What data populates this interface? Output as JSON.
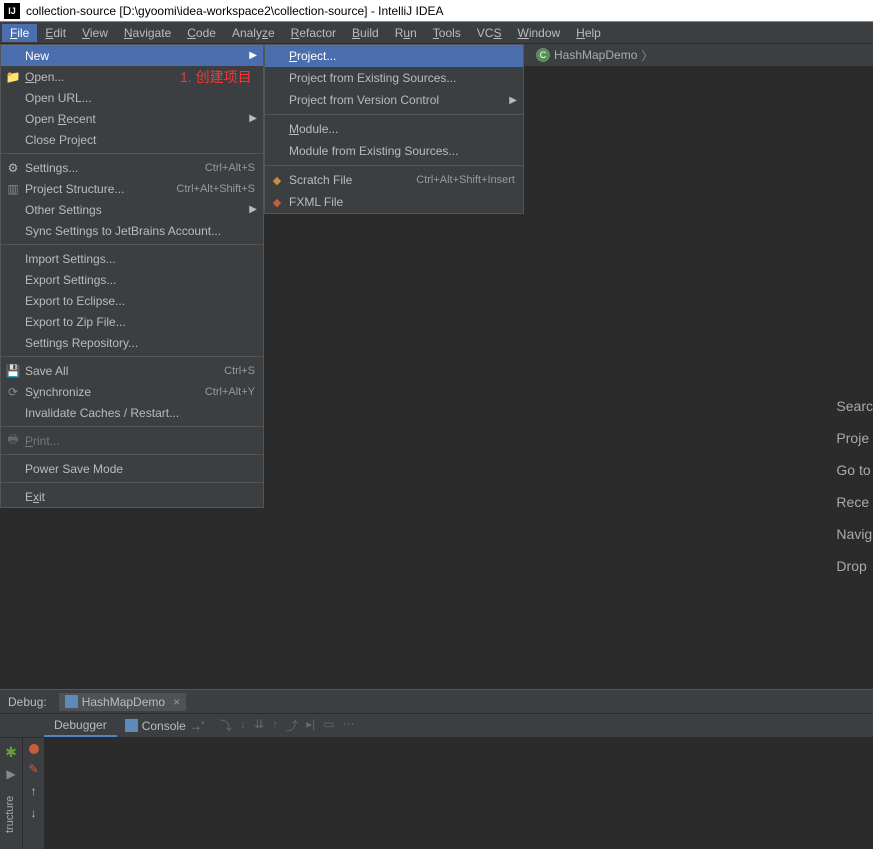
{
  "titlebar": {
    "text": "collection-source [D:\\gyoomi\\idea-workspace2\\collection-source] - IntelliJ IDEA"
  },
  "menubar": {
    "items": [
      "File",
      "Edit",
      "View",
      "Navigate",
      "Code",
      "Analyze",
      "Refactor",
      "Build",
      "Run",
      "Tools",
      "VCS",
      "Window",
      "Help"
    ]
  },
  "breadcrumb": {
    "item": "HashMapDemo"
  },
  "annotation": "1. 创建项目",
  "file_menu": {
    "groups": [
      [
        {
          "label": "New",
          "highlighted": true,
          "arrow": true
        },
        {
          "label": "Open...",
          "icon": "folder",
          "underline": "O"
        },
        {
          "label": "Open URL..."
        },
        {
          "label": "Open Recent",
          "arrow": true,
          "underline": "R"
        },
        {
          "label": "Close Project"
        }
      ],
      [
        {
          "label": "Settings...",
          "icon": "gear",
          "shortcut": "Ctrl+Alt+S"
        },
        {
          "label": "Project Structure...",
          "icon": "structure",
          "shortcut": "Ctrl+Alt+Shift+S"
        },
        {
          "label": "Other Settings",
          "arrow": true
        },
        {
          "label": "Sync Settings to JetBrains Account..."
        }
      ],
      [
        {
          "label": "Import Settings..."
        },
        {
          "label": "Export Settings..."
        },
        {
          "label": "Export to Eclipse..."
        },
        {
          "label": "Export to Zip File..."
        },
        {
          "label": "Settings Repository..."
        }
      ],
      [
        {
          "label": "Save All",
          "icon": "save",
          "shortcut": "Ctrl+S"
        },
        {
          "label": "Synchronize",
          "icon": "sync",
          "shortcut": "Ctrl+Alt+Y",
          "underline": "y"
        },
        {
          "label": "Invalidate Caches / Restart..."
        }
      ],
      [
        {
          "label": "Print...",
          "icon": "print",
          "disabled": true,
          "underline": "P"
        }
      ],
      [
        {
          "label": "Power Save Mode"
        }
      ],
      [
        {
          "label": "Exit",
          "underline": "x"
        }
      ]
    ]
  },
  "submenu": {
    "groups": [
      [
        {
          "label": "Project...",
          "highlighted": true,
          "underline": "P"
        },
        {
          "label": "Project from Existing Sources..."
        },
        {
          "label": "Project from Version Control",
          "arrow": true
        }
      ],
      [
        {
          "label": "Module...",
          "underline": "M"
        },
        {
          "label": "Module from Existing Sources..."
        }
      ],
      [
        {
          "label": "Scratch File",
          "icon": "scratch",
          "shortcut": "Ctrl+Alt+Shift+Insert"
        },
        {
          "label": "FXML File",
          "icon": "fxml"
        }
      ]
    ]
  },
  "welcome": {
    "links": [
      "Searc",
      "Proje",
      "Go to",
      "Rece",
      "Navig",
      "Drop"
    ]
  },
  "debug": {
    "title": "Debug:",
    "tab": "HashMapDemo",
    "tabs": {
      "debugger": "Debugger",
      "console": "Console"
    }
  },
  "sidetab": "tructure"
}
